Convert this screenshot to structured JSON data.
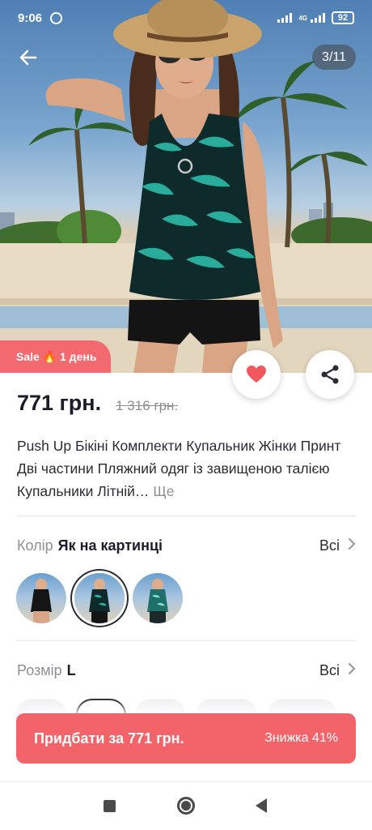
{
  "status_bar": {
    "time": "9:06",
    "network": "4G",
    "battery": "92"
  },
  "gallery": {
    "counter": "3/11",
    "badge": "Sale 🔥 1 день"
  },
  "product": {
    "price": "771 грн.",
    "old_price": "1 316 грн.",
    "title": "Push Up Бікіні Комплекти Купальник Жінки Принт Дві частини Пляжний одяг із завищеною талією Купальники Літній…",
    "more": "Ще"
  },
  "color_option": {
    "label": "Колір",
    "value": "Як на картинці",
    "all": "Всі",
    "swatches": [
      "black",
      "green-tropical",
      "teal-tropical"
    ],
    "selected_index": 1
  },
  "size_option": {
    "label": "Розмір",
    "value": "L",
    "all": "Всі"
  },
  "buy": {
    "label": "Придбати за 771 грн.",
    "discount": "Знижка 41%"
  },
  "colors": {
    "accent": "#f2646a",
    "badge": "#f26a70",
    "heart": "#f0585e"
  }
}
